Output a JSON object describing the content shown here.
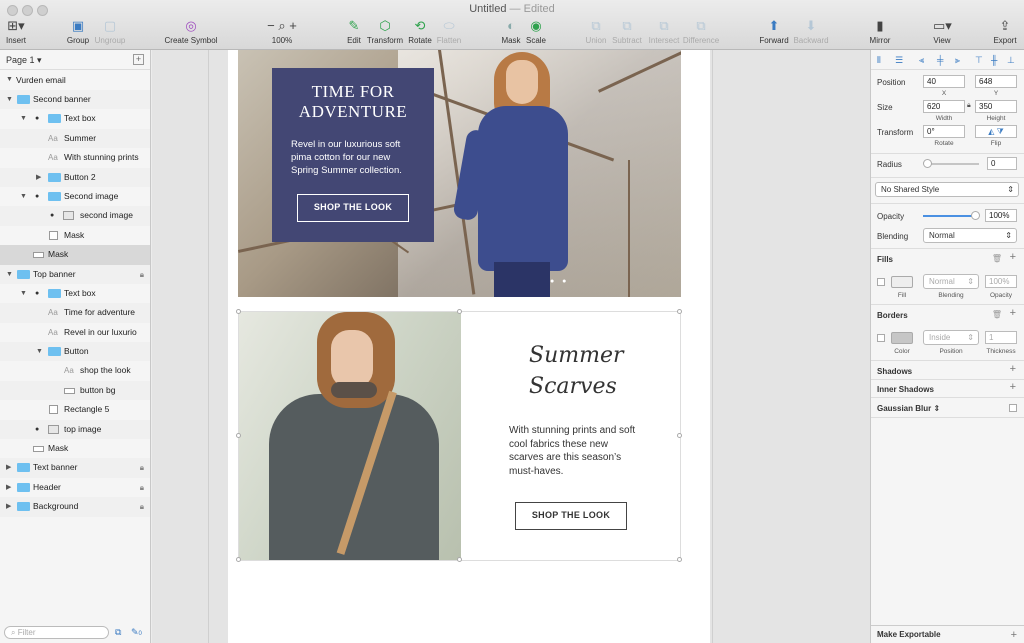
{
  "window": {
    "title": "Untitled",
    "status": "— Edited"
  },
  "toolbar": {
    "insert": "Insert",
    "group": "Group",
    "ungroup": "Ungroup",
    "create_symbol": "Create Symbol",
    "zoom_minus": "−",
    "zoom_plus": "+",
    "zoom": "100%",
    "edit": "Edit",
    "transform": "Transform",
    "rotate": "Rotate",
    "flatten": "Flatten",
    "mask": "Mask",
    "scale": "Scale",
    "union": "Union",
    "subtract": "Subtract",
    "intersect": "Intersect",
    "difference": "Difference",
    "forward": "Forward",
    "backward": "Backward",
    "mirror": "Mirror",
    "view": "View",
    "export": "Export"
  },
  "layers": {
    "page": "Page 1",
    "artboard": "Vurden email",
    "items": [
      {
        "label": "Second banner"
      },
      {
        "label": "Text box"
      },
      {
        "label": "Summer"
      },
      {
        "label": "With stunning prints"
      },
      {
        "label": "Button 2"
      },
      {
        "label": "Second image"
      },
      {
        "label": "second image"
      },
      {
        "label": "Mask"
      },
      {
        "label": "Mask"
      },
      {
        "label": "Top banner"
      },
      {
        "label": "Text box"
      },
      {
        "label": "Time for adventure"
      },
      {
        "label": "Revel in our luxurio"
      },
      {
        "label": "Button"
      },
      {
        "label": "shop the look"
      },
      {
        "label": "button bg"
      },
      {
        "label": "Rectangle 5"
      },
      {
        "label": "top image"
      },
      {
        "label": "Mask"
      },
      {
        "label": "Text banner"
      },
      {
        "label": "Header"
      },
      {
        "label": "Background"
      }
    ],
    "filter_placeholder": "Filter",
    "filter_count": "0"
  },
  "canvas": {
    "top_banner": {
      "title_line1": "TIME FOR",
      "title_line2": "ADVENTURE",
      "body": "Revel in our luxurious soft pima cotton for our new Spring Summer collection.",
      "button": "SHOP THE LOOK"
    },
    "second_banner": {
      "title_line1": "Summer",
      "title_line2": "Scarves",
      "body": "With stunning prints and soft cool fabrics these new scarves are this season’s must-haves.",
      "button": "SHOP THE LOOK"
    }
  },
  "inspector": {
    "position_label": "Position",
    "x": "40",
    "y": "648",
    "x_label": "X",
    "y_label": "Y",
    "size_label": "Size",
    "width": "620",
    "height": "350",
    "width_label": "Width",
    "height_label": "Height",
    "transform_label": "Transform",
    "rotate": "0°",
    "rotate_label": "Rotate",
    "flip_label": "Flip",
    "radius_label": "Radius",
    "radius": "0",
    "shared_style": "No Shared Style",
    "opacity_label": "Opacity",
    "opacity": "100%",
    "blending_label": "Blending",
    "blending": "Normal",
    "fills_label": "Fills",
    "fill_blend": "Normal",
    "fill_opacity": "100%",
    "fill_sub": "Fill",
    "fill_blend_sub": "Blending",
    "fill_opacity_sub": "Opacity",
    "borders_label": "Borders",
    "border_position": "Inside",
    "border_thickness": "1",
    "border_color_sub": "Color",
    "border_position_sub": "Position",
    "border_thickness_sub": "Thickness",
    "shadows_label": "Shadows",
    "inner_shadows_label": "Inner Shadows",
    "gaussian_label": "Gaussian Blur",
    "make_exportable": "Make Exportable"
  }
}
